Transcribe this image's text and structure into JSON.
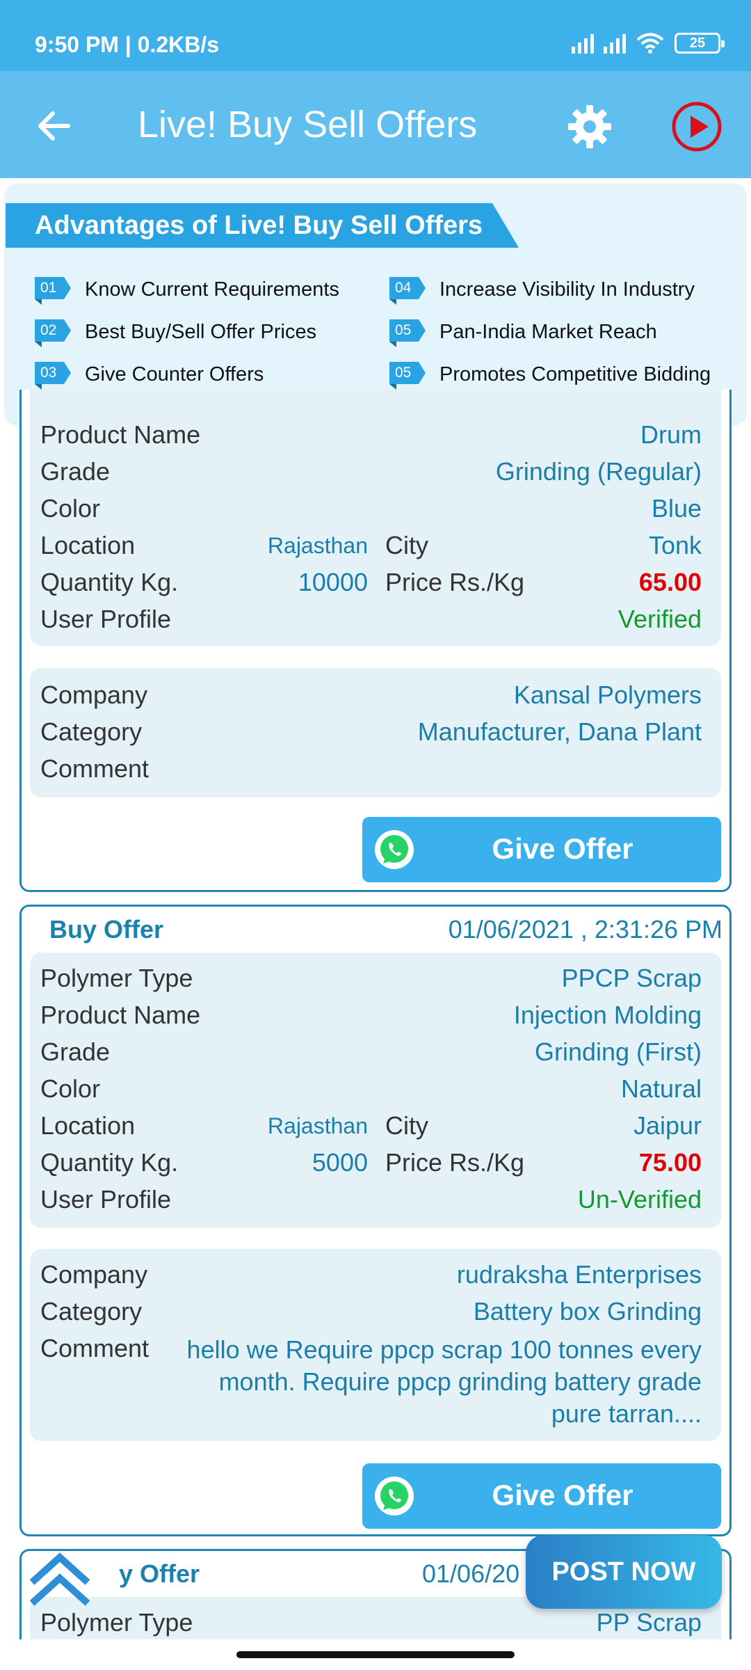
{
  "status": {
    "time": "9:50 PM | 0.2KB/s",
    "battery": "25"
  },
  "header": {
    "title": "Live! Buy Sell Offers"
  },
  "advantages": {
    "title": "Advantages of Live! Buy Sell Offers",
    "items": [
      {
        "num": "01",
        "text": "Know Current Requirements"
      },
      {
        "num": "02",
        "text": "Best Buy/Sell Offer Prices"
      },
      {
        "num": "03",
        "text": "Give Counter Offers"
      },
      {
        "num": "04",
        "text": "Increase Visibility In Industry"
      },
      {
        "num": "05",
        "text": "Pan-India Market Reach"
      },
      {
        "num": "05",
        "text": "Promotes Competitive Bidding"
      }
    ]
  },
  "labels": {
    "polymer_type": "Polymer Type",
    "product_name": "Product Name",
    "grade": "Grade",
    "color": "Color",
    "location": "Location",
    "city": "City",
    "quantity": "Quantity Kg.",
    "price": "Price Rs./Kg",
    "user_profile": "User Profile",
    "company": "Company",
    "category": "Category",
    "comment": "Comment",
    "give_offer": "Give Offer"
  },
  "offers": [
    {
      "product_name": "Drum",
      "grade": "Grinding (Regular)",
      "color": "Blue",
      "location": "Rajasthan",
      "city": "Tonk",
      "quantity": "10000",
      "price": "65.00",
      "user_profile": "Verified",
      "company": "Kansal Polymers",
      "category": "Manufacturer, Dana Plant",
      "comment": ""
    },
    {
      "type": "Buy Offer",
      "date": "01/06/2021 , 2:31:26 PM",
      "polymer_type": "PPCP Scrap",
      "product_name": "Injection Molding",
      "grade": "Grinding (First)",
      "color": "Natural",
      "location": "Rajasthan",
      "city": "Jaipur",
      "quantity": "5000",
      "price": "75.00",
      "user_profile": "Un-Verified",
      "company": "rudraksha Enterprises",
      "category": "Battery box Grinding",
      "comment": "hello we Require ppcp scrap 100 tonnes every month. Require ppcp grinding battery grade pure tarran...."
    },
    {
      "type": "y Offer",
      "date": "01/06/20",
      "polymer_type": "PP Scrap"
    }
  ],
  "fab": {
    "post_now": "POST  NOW"
  },
  "colors": {
    "statusbar": "#3eb1ea",
    "appbar": "#61bfef",
    "accent": "#2aa3e2",
    "price_red": "#e00000",
    "verified_green": "#119a2d"
  }
}
